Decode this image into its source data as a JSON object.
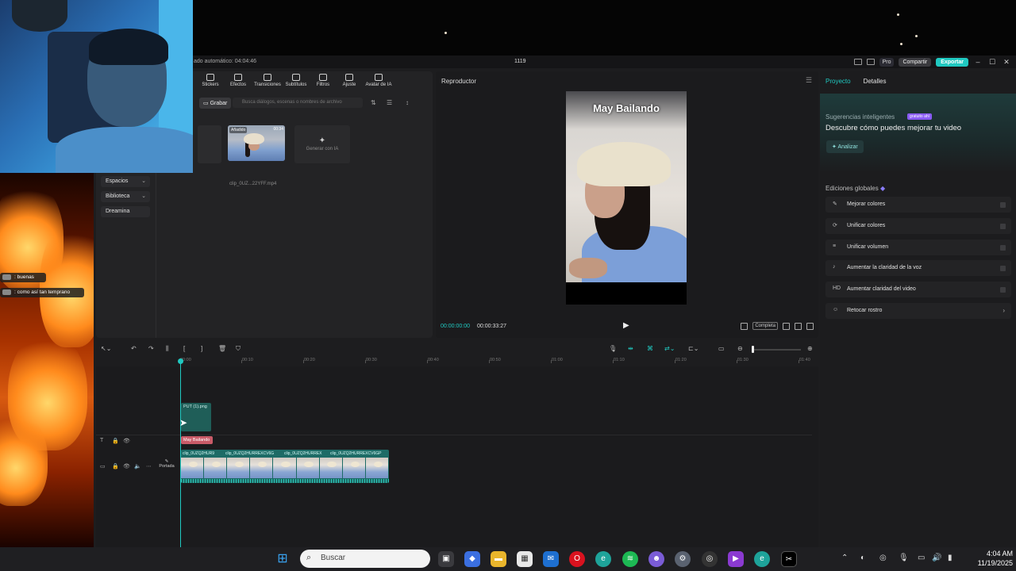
{
  "app": {
    "autosave_text": "ado automático: 04:04:46",
    "project_name": "1119",
    "pro_label": "Pro",
    "share_label": "Compartir",
    "export_label": "Exportar"
  },
  "media_toolbar": [
    "Stickers",
    "Efectos",
    "Transiciones",
    "Subtítulos",
    "Filtros",
    "Ajuste",
    "Avatar de IA"
  ],
  "media": {
    "record_label": "Grabar",
    "search_placeholder": "Busca diálogos, escenas o nombres de archivo",
    "sidebar": [
      "Espacios",
      "Biblioteca",
      "Dreamina"
    ],
    "clip_badge": "Añadido",
    "clip_duration": "00:34",
    "clip_name": "clip_0UZ...22YFF.mp4",
    "generate_label": "Generar con IA"
  },
  "player": {
    "title": "Reproductor",
    "video_title": "May Bailando",
    "current_time": "00:00:00:00",
    "total_time": "00:00:33:27",
    "ratio_label": "Completa"
  },
  "right_panel": {
    "tab_project": "Proyecto",
    "tab_details": "Detalles",
    "suggestions_title": "Sugerencias inteligentes",
    "free_badge": "gratuito ahí",
    "suggestions_text": "Descubre cómo puedes mejorar tu video",
    "analyze_label": "Analizar",
    "global_title": "Ediciones globales",
    "items": [
      {
        "icon": "✎",
        "label": "Mejorar colores"
      },
      {
        "icon": "⟳",
        "label": "Unificar colores"
      },
      {
        "icon": "≡",
        "label": "Unificar volumen"
      },
      {
        "icon": "♪",
        "label": "Aumentar la claridad de la voz"
      },
      {
        "icon": "HD",
        "label": "Aumentar claridad del video"
      },
      {
        "icon": "☺",
        "label": "Retocar rostro"
      }
    ]
  },
  "timeline": {
    "ticks": [
      "00:00",
      "00:10",
      "00:20",
      "00:30",
      "00:40",
      "00:50",
      "01:00",
      "01:10",
      "01:20",
      "01:30",
      "01:40"
    ],
    "sticker_clip": "PUT (1).png",
    "text_clip": "May Bailando",
    "main_clip_names": [
      "clip_0UZQ2HUR9",
      "clip_0UZQ2HURREXCV6G",
      "clip_0UZQ2HURREX",
      "clip_0UZQ2HURREXCV6GP"
    ],
    "cover_label": "Portada"
  },
  "chat": [
    {
      "text": ": buenas"
    },
    {
      "text": ": como así tan temprano"
    }
  ],
  "taskbar": {
    "search_label": "Buscar",
    "time": "4:04 AM",
    "date": "11/19/2025"
  }
}
